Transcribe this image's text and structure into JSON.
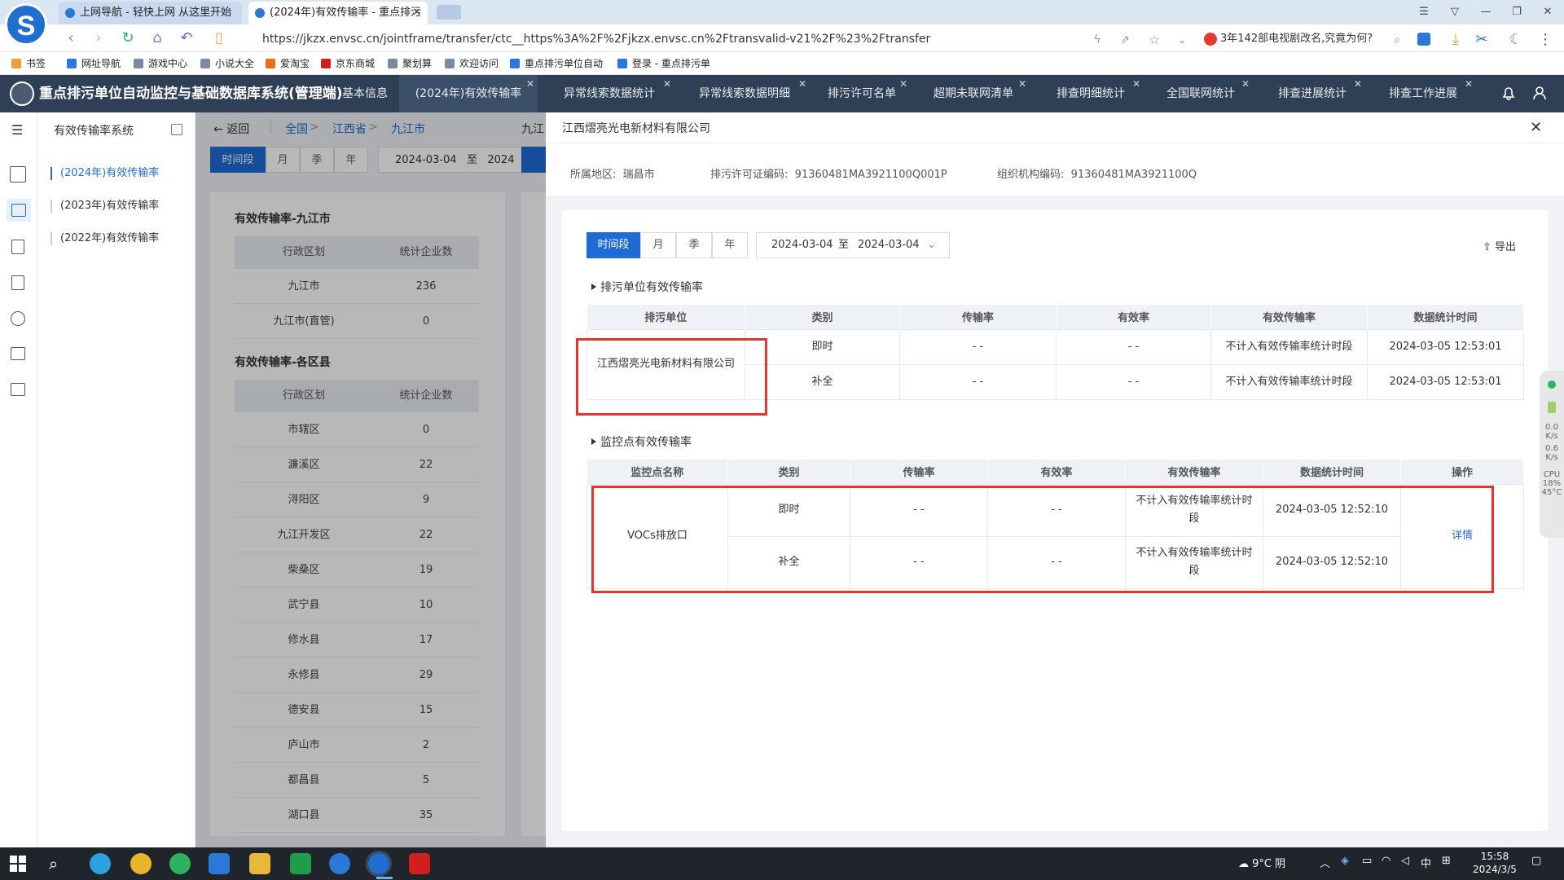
{
  "browser": {
    "tabs": [
      {
        "title": "上网导航 - 轻快上网 从这里开始"
      },
      {
        "title": "(2024年)有效传输率 - 重点排污"
      }
    ],
    "url": "https://jkzx.envsc.cn/jointframe/transfer/ctc__https%3A%2F%2Fjkzx.envsc.cn%2Ftransvalid-v21%2F%23%2Ftransfer",
    "news": "3年142部电视剧改名,究竟为何?",
    "bookmarks": [
      "书签",
      "网址导航",
      "游戏中心",
      "小说大全",
      "爱淘宝",
      "京东商城",
      "聚划算",
      "欢迎访问",
      "重点排污单位自动",
      "登录 - 重点排污单"
    ]
  },
  "app": {
    "title": "重点排污单位自动监控与基础数据库系统(管理端)",
    "nav_tabs": [
      "基本信息",
      "(2024年)有效传输率",
      "异常线索数据统计",
      "异常线索数据明细",
      "排污许可名单",
      "超期未联网清单",
      "排查明细统计",
      "全国联网统计",
      "排查进展统计",
      "排查工作进展"
    ]
  },
  "sidebar": {
    "title": "有效传输率系统",
    "items": [
      "(2024年)有效传输率",
      "(2023年)有效传输率",
      "(2022年)有效传输率"
    ]
  },
  "background": {
    "back_label": "返回",
    "crumbs": [
      "全国",
      "江西省",
      "九江市"
    ],
    "crumb_right": "九江",
    "seg": [
      "时间段",
      "月",
      "季",
      "年"
    ],
    "date_from": "2024-03-04",
    "date_sep": "至",
    "date_to_partial": "2024",
    "table1_title": "有效传输率-九江市",
    "table2_title": "有效传输率-各区县",
    "headers": [
      "行政区划",
      "统计企业数"
    ],
    "rows1": [
      [
        "九江市",
        "236"
      ],
      [
        "九江市(直管)",
        "0"
      ]
    ],
    "rows2": [
      [
        "市辖区",
        "0"
      ],
      [
        "濂溪区",
        "22"
      ],
      [
        "浔阳区",
        "9"
      ],
      [
        "九江开发区",
        "22"
      ],
      [
        "柴桑区",
        "19"
      ],
      [
        "武宁县",
        "10"
      ],
      [
        "修水县",
        "17"
      ],
      [
        "永修县",
        "29"
      ],
      [
        "德安县",
        "15"
      ],
      [
        "庐山市",
        "2"
      ],
      [
        "都昌县",
        "5"
      ],
      [
        "湖口县",
        "35"
      ]
    ]
  },
  "drawer": {
    "title": "江西熠亮光电新材料有限公司",
    "region_label": "所属地区:",
    "region": "瑞昌市",
    "permit_label": "排污许可证编码:",
    "permit": "91360481MA3921100Q001P",
    "org_label": "组织机构编码:",
    "org": "91360481MA3921100Q",
    "seg": [
      "时间段",
      "月",
      "季",
      "年"
    ],
    "date_from": "2024-03-04",
    "date_sep": "至",
    "date_to": "2024-03-04",
    "export": "导出",
    "section1": "排污单位有效传输率",
    "table1": {
      "headers": [
        "排污单位",
        "类别",
        "传输率",
        "有效率",
        "有效传输率",
        "数据统计时间"
      ],
      "unit": "江西熠亮光电新材料有限公司",
      "rows": [
        [
          "即时",
          "- -",
          "- -",
          "不计入有效传输率统计时段",
          "2024-03-05 12:53:01"
        ],
        [
          "补全",
          "- -",
          "- -",
          "不计入有效传输率统计时段",
          "2024-03-05 12:53:01"
        ]
      ]
    },
    "section2": "监控点有效传输率",
    "table2": {
      "headers": [
        "监控点名称",
        "类别",
        "传输率",
        "有效率",
        "有效传输率",
        "数据统计时间",
        "操作"
      ],
      "point": "VOCs排放口",
      "rows": [
        [
          "即时",
          "- -",
          "- -",
          "不计入有效传输率统计时段",
          "2024-03-05 12:52:10"
        ],
        [
          "补全",
          "- -",
          "- -",
          "不计入有效传输率统计时段",
          "2024-03-05 12:52:10"
        ]
      ],
      "action": "详情"
    }
  },
  "widget": {
    "v1": "0.0",
    "u1": "K/s",
    "v2": "0.6",
    "u2": "K/s",
    "cpu": "CPU",
    "pct": "18%",
    "temp": "45°C"
  },
  "taskbar": {
    "weather": "9°C 阴",
    "ime": "中",
    "time": "15:58",
    "date": "2024/3/5"
  }
}
